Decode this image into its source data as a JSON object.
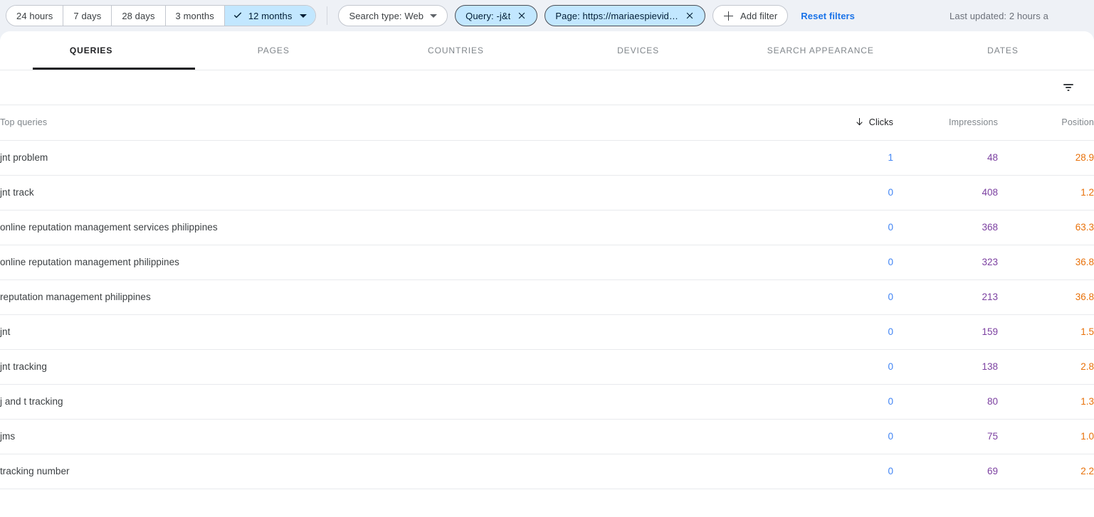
{
  "topbar": {
    "date_ranges": [
      {
        "label": "24 hours",
        "active": false
      },
      {
        "label": "7 days",
        "active": false
      },
      {
        "label": "28 days",
        "active": false
      },
      {
        "label": "3 months",
        "active": false
      },
      {
        "label": "12 months",
        "active": true
      }
    ],
    "chips": [
      {
        "label": "Search type: Web",
        "type": "plain",
        "trailing_icon": "chevron-down-icon"
      },
      {
        "label": "Query: -j&t",
        "type": "selected",
        "trailing_icon": "close-icon"
      },
      {
        "label": "Page: https://mariaespievid…",
        "type": "selected",
        "trailing_icon": "close-icon"
      }
    ],
    "add_filter_label": "Add filter",
    "add_filter_icon": "plus-icon",
    "reset_label": "Reset filters",
    "last_updated": "Last updated: 2 hours a"
  },
  "tabs": [
    {
      "label": "QUERIES",
      "active": true
    },
    {
      "label": "PAGES",
      "active": false
    },
    {
      "label": "COUNTRIES",
      "active": false
    },
    {
      "label": "DEVICES",
      "active": false
    },
    {
      "label": "SEARCH APPEARANCE",
      "active": false
    },
    {
      "label": "DATES",
      "active": false
    }
  ],
  "toolbar": {
    "filter_icon": "filter-funnel-icon"
  },
  "table": {
    "columns": [
      {
        "label": "Top queries",
        "align": "left",
        "sorted": false
      },
      {
        "label": "Clicks",
        "align": "right",
        "sorted": true,
        "sort_direction": "desc",
        "sort_icon": "arrow-down-icon"
      },
      {
        "label": "Impressions",
        "align": "right",
        "sorted": false
      },
      {
        "label": "Position",
        "align": "right",
        "sorted": false
      }
    ],
    "rows": [
      {
        "query": "jnt problem",
        "clicks": "1",
        "impressions": "48",
        "position": "28.9"
      },
      {
        "query": "jnt track",
        "clicks": "0",
        "impressions": "408",
        "position": "1.2"
      },
      {
        "query": "online reputation management services philippines",
        "clicks": "0",
        "impressions": "368",
        "position": "63.3"
      },
      {
        "query": "online reputation management philippines",
        "clicks": "0",
        "impressions": "323",
        "position": "36.8"
      },
      {
        "query": "reputation management philippines",
        "clicks": "0",
        "impressions": "213",
        "position": "36.8"
      },
      {
        "query": "jnt",
        "clicks": "0",
        "impressions": "159",
        "position": "1.5"
      },
      {
        "query": "jnt tracking",
        "clicks": "0",
        "impressions": "138",
        "position": "2.8"
      },
      {
        "query": "j and t tracking",
        "clicks": "0",
        "impressions": "80",
        "position": "1.3"
      },
      {
        "query": "jms",
        "clicks": "0",
        "impressions": "75",
        "position": "1.0"
      },
      {
        "query": "tracking number",
        "clicks": "0",
        "impressions": "69",
        "position": "2.2"
      }
    ]
  },
  "colors": {
    "page_background": "#eef1f6",
    "card_background": "#ffffff",
    "accent_link": "#1a73e8",
    "chip_selected_fill": "#c2e7ff",
    "clicks_value": "#4285f4",
    "impressions_value": "#7b3fa0",
    "position_value": "#e8710a",
    "active_tab_underline": "#202124"
  }
}
